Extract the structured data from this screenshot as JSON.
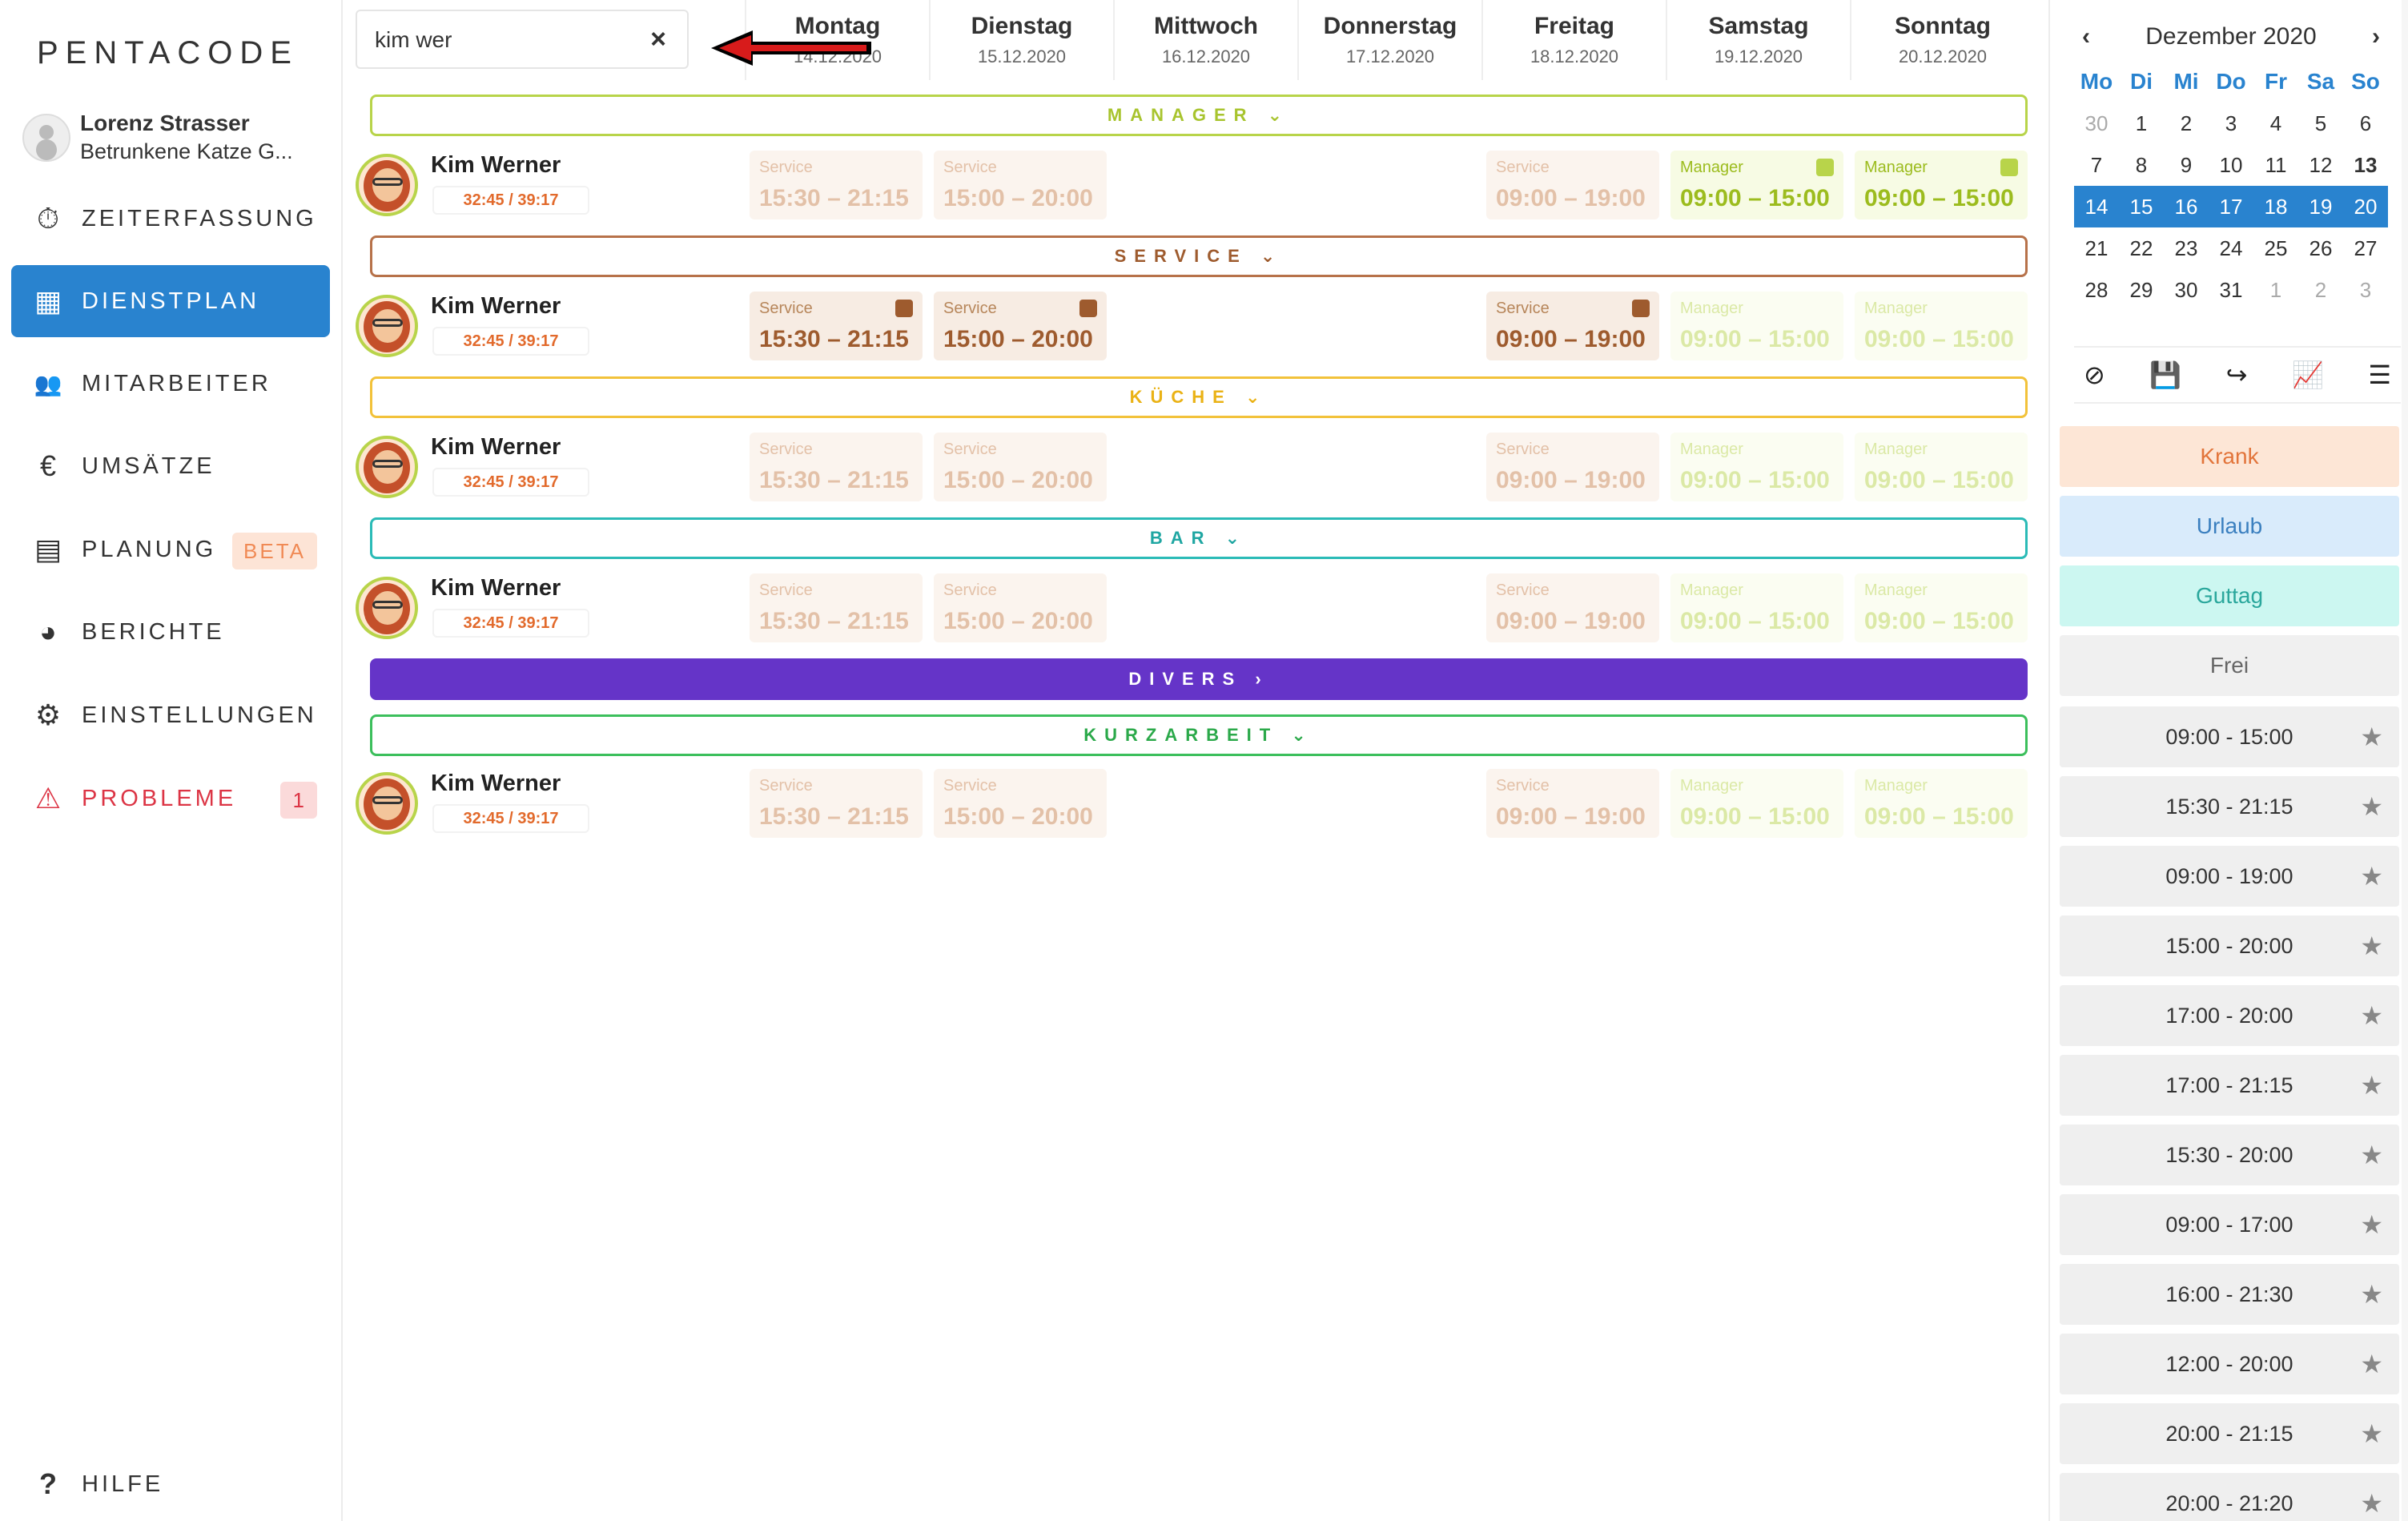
{
  "app": {
    "logo": "PENTACODE"
  },
  "user": {
    "name": "Lorenz Strasser",
    "company": "Betrunkene Katze G..."
  },
  "nav": [
    {
      "icon": "⏱",
      "label": "ZEITERFASSUNG"
    },
    {
      "icon": "▦",
      "label": "DIENSTPLAN"
    },
    {
      "icon": "👥",
      "label": "MITARBEITER"
    },
    {
      "icon": "€",
      "label": "UMSÄTZE"
    },
    {
      "icon": "▤",
      "label": "PLANUNG",
      "badge": "BETA"
    },
    {
      "icon": "◕",
      "label": "BERICHTE"
    },
    {
      "icon": "⚙",
      "label": "EINSTELLUNGEN"
    },
    {
      "icon": "⚠",
      "label": "PROBLEME",
      "badge": "1"
    }
  ],
  "help": {
    "icon": "?",
    "label": "HILFE"
  },
  "search": {
    "value": "kim wer",
    "clear": "×"
  },
  "days": [
    {
      "name": "Montag",
      "date": "14.12.2020"
    },
    {
      "name": "Dienstag",
      "date": "15.12.2020"
    },
    {
      "name": "Mittwoch",
      "date": "16.12.2020"
    },
    {
      "name": "Donnerstag",
      "date": "17.12.2020"
    },
    {
      "name": "Freitag",
      "date": "18.12.2020"
    },
    {
      "name": "Samstag",
      "date": "19.12.2020"
    },
    {
      "name": "Sonntag",
      "date": "20.12.2020"
    }
  ],
  "groups": {
    "manager": "MANAGER ⌄",
    "service": "SERVICE ⌄",
    "kueche": "KÜCHE ⌄",
    "bar": "BAR ⌄",
    "divers": "DIVERS ›",
    "kurzarbeit": "KURZARBEIT ⌄"
  },
  "employee": {
    "name": "Kim Werner",
    "hours": "32:45 / 39:17"
  },
  "shifts": {
    "mon": {
      "cat": "Service",
      "time": "15:30 – 21:15"
    },
    "tue": {
      "cat": "Service",
      "time": "15:00 – 20:00"
    },
    "fri": {
      "cat": "Service",
      "time": "09:00 – 19:00"
    },
    "sat": {
      "cat": "Manager",
      "time": "09:00 – 15:00"
    },
    "sun": {
      "cat": "Manager",
      "time": "09:00 – 15:00"
    }
  },
  "colors": {
    "manager": "#b8d44a",
    "service": "#b7724a",
    "kueche": "#f2c23a",
    "bar": "#2bbbb7",
    "divers": "#6534c8",
    "kurzarbeit": "#3cbf5c",
    "accent": "#2983cf"
  },
  "calendar": {
    "title": "Dezember 2020",
    "weekdays": [
      "Mo",
      "Di",
      "Mi",
      "Do",
      "Fr",
      "Sa",
      "So"
    ],
    "weeks": [
      [
        "30",
        "1",
        "2",
        "3",
        "4",
        "5",
        "6"
      ],
      [
        "7",
        "8",
        "9",
        "10",
        "11",
        "12",
        "13"
      ],
      [
        "14",
        "15",
        "16",
        "17",
        "18",
        "19",
        "20"
      ],
      [
        "21",
        "22",
        "23",
        "24",
        "25",
        "26",
        "27"
      ],
      [
        "28",
        "29",
        "30",
        "31",
        "1",
        "2",
        "3"
      ]
    ]
  },
  "tools": [
    "block-icon",
    "save-icon",
    "share-icon",
    "chart-icon",
    "list-icon"
  ],
  "absences": [
    {
      "label": "Krank",
      "bg": "#fde6d6",
      "fg": "#e2743a"
    },
    {
      "label": "Urlaub",
      "bg": "#d9ebfb",
      "fg": "#3a7fbf"
    },
    {
      "label": "Guttag",
      "bg": "#ccf7f1",
      "fg": "#2aa79c"
    },
    {
      "label": "Frei",
      "bg": "#f0f0f0",
      "fg": "#666"
    }
  ],
  "favorites": [
    "09:00 - 15:00",
    "15:30 - 21:15",
    "09:00 - 19:00",
    "15:00 - 20:00",
    "17:00 - 20:00",
    "17:00 - 21:15",
    "15:30 - 20:00",
    "09:00 - 17:00",
    "16:00 - 21:30",
    "12:00 - 20:00",
    "20:00 - 21:15",
    "20:00 - 21:20"
  ]
}
